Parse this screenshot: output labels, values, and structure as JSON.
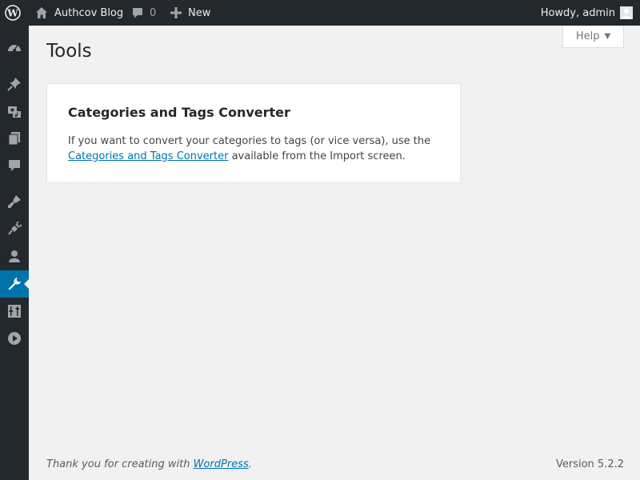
{
  "admin_bar": {
    "site_name": "Authcov Blog",
    "comments_count": "0",
    "new_label": "New",
    "greeting": "Howdy, admin"
  },
  "sidebar": {
    "items": [
      {
        "icon": "dashboard-icon"
      },
      {
        "icon": "pin-icon"
      },
      {
        "icon": "media-icon"
      },
      {
        "icon": "pages-icon"
      },
      {
        "icon": "comments-icon"
      },
      {
        "icon": "appearance-icon"
      },
      {
        "icon": "plugins-icon"
      },
      {
        "icon": "users-icon"
      },
      {
        "icon": "tools-icon",
        "current": true
      },
      {
        "icon": "settings-icon"
      },
      {
        "icon": "play-icon"
      }
    ],
    "colors": {
      "background": "#23282d",
      "active": "#0073aa"
    }
  },
  "help": {
    "label": "Help"
  },
  "page": {
    "title": "Tools"
  },
  "card": {
    "title": "Categories and Tags Converter",
    "text_before": "If you want to convert your categories to tags (or vice versa), use the ",
    "link_text": "Categories and Tags Converter",
    "text_after": " available from the Import screen."
  },
  "footer": {
    "thanks_before": "Thank you for creating with ",
    "thanks_link": "WordPress",
    "thanks_after": ".",
    "version": "Version 5.2.2"
  }
}
